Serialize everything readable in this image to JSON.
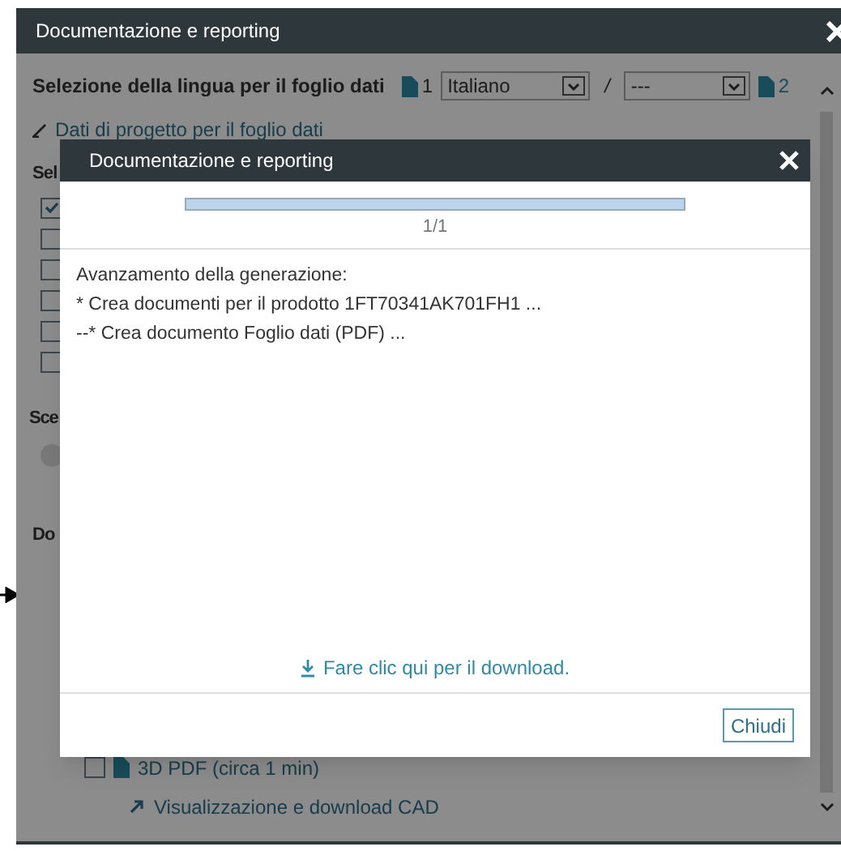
{
  "window": {
    "title": "Documentazione e reporting"
  },
  "language_row": {
    "label": "Selezione della lingua per il foglio dati",
    "first_index": "1",
    "first_language": "Italiano",
    "separator": "/",
    "second_language": "---",
    "second_index": "2"
  },
  "design_data_link": "Dati di progetto per il foglio dati",
  "section_1_label": "Sel",
  "checkboxes": [
    {
      "checked": true
    },
    {
      "checked": false
    },
    {
      "checked": false
    },
    {
      "checked": false
    },
    {
      "checked": false
    },
    {
      "checked": false
    }
  ],
  "section_2_label": "Sce",
  "radio": {
    "selected": false
  },
  "section_3_label": "Do",
  "pdf_option": {
    "label": "3D PDF (circa 1 min)",
    "checked": false
  },
  "cad_link": "Visualizzazione e download CAD",
  "dialog": {
    "title": "Documentazione e reporting",
    "progress": {
      "level": 1,
      "reading": "1/1"
    },
    "log": [
      "Avanzamento della generazione:",
      "* Crea documenti per il prodotto 1FT70341AK701FH1 ...",
      "--* Crea documento Foglio dati (PDF) ..."
    ],
    "download_link": "Fare clic qui per il download.",
    "close_button": "Chiudi"
  }
}
